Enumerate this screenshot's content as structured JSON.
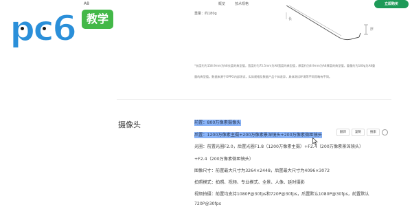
{
  "nav": {
    "title": "A8",
    "links": [
      "概览",
      "技术规格"
    ],
    "buy_label": "立即购买"
  },
  "logo": {
    "text": "pc6",
    "badge": "教学"
  },
  "specs": {
    "weight_text": "重量：约180g",
    "illustration": {
      "length_label": "长",
      "thickness_label": "厚"
    },
    "note": "*长度约为158.9mm为A8长度的典型值，宽度约为75.5mm为A8宽度的典型值，厚度约为8.9mm为A8厚度的典型值，重量约为180g为A8重量的典型值。数据来源于OPPO内部测试，实际规格及数据产品个体差异，具体测试环境等不同而略有不同。"
  },
  "camera": {
    "title": "摄像头",
    "rows": [
      {
        "text": "前置：800万像素摄像头",
        "selected": true
      },
      {
        "text": "后置：1200万像素主摄+200万像素景深镜头+200万像素微距镜头",
        "selected": true
      },
      {
        "text": "光圈：前置光圈F2.0，后置光圈F1.8（1200万像素主摄）+F2.4（200万像素景深镜头）",
        "selected": false
      },
      {
        "text": "+F2.4（200万像素微距镜头）",
        "selected": false
      },
      {
        "text": "图像尺寸：前置最大尺寸为3264×2448，后置最大尺寸为4096×3072",
        "selected": false
      },
      {
        "text": "拍照模式：拍照、视频、专业模式、全景、人像、延时摄影",
        "selected": false
      },
      {
        "text": "视频拍摄：前置均支持1080P@30fps和720P@30fps，后置默认1080P@30fps，前置默认",
        "selected": false
      },
      {
        "text": "720P@30fps",
        "selected": false
      }
    ]
  },
  "toolbar": {
    "buttons": [
      "翻译",
      "复制",
      "搜索"
    ]
  },
  "colors": {
    "accent_green": "#1e9a58",
    "selection": "#8ab4f8",
    "logo_blue": "#2a8fd9",
    "badge_green": "#43b848"
  }
}
